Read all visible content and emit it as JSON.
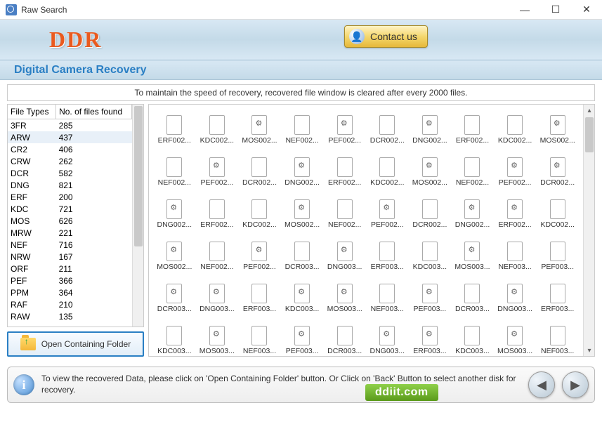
{
  "window": {
    "title": "Raw Search"
  },
  "header": {
    "logo": "DDR",
    "product": "Digital Camera Recovery",
    "contact_label": "Contact us"
  },
  "notice": "To maintain the speed of recovery, recovered file window is cleared after every 2000 files.",
  "file_types_table": {
    "columns": [
      "File Types",
      "No. of files found"
    ],
    "rows": [
      {
        "type": "3FR",
        "count": 285
      },
      {
        "type": "ARW",
        "count": 437
      },
      {
        "type": "CR2",
        "count": 406
      },
      {
        "type": "CRW",
        "count": 262
      },
      {
        "type": "DCR",
        "count": 582
      },
      {
        "type": "DNG",
        "count": 821
      },
      {
        "type": "ERF",
        "count": 200
      },
      {
        "type": "KDC",
        "count": 721
      },
      {
        "type": "MOS",
        "count": 626
      },
      {
        "type": "MRW",
        "count": 221
      },
      {
        "type": "NEF",
        "count": 716
      },
      {
        "type": "NRW",
        "count": 167
      },
      {
        "type": "ORF",
        "count": 211
      },
      {
        "type": "PEF",
        "count": 366
      },
      {
        "type": "PPM",
        "count": 364
      },
      {
        "type": "RAF",
        "count": 210
      },
      {
        "type": "RAW",
        "count": 135
      }
    ]
  },
  "open_folder_label": "Open Containing Folder",
  "files": [
    {
      "name": "ERF002...",
      "gear": false
    },
    {
      "name": "KDC002...",
      "gear": false
    },
    {
      "name": "MOS002...",
      "gear": true
    },
    {
      "name": "NEF002...",
      "gear": false
    },
    {
      "name": "PEF002...",
      "gear": true
    },
    {
      "name": "DCR002...",
      "gear": false
    },
    {
      "name": "DNG002...",
      "gear": true
    },
    {
      "name": "ERF002...",
      "gear": false
    },
    {
      "name": "KDC002...",
      "gear": false
    },
    {
      "name": "MOS002...",
      "gear": true
    },
    {
      "name": "NEF002...",
      "gear": false
    },
    {
      "name": "PEF002...",
      "gear": true
    },
    {
      "name": "DCR002...",
      "gear": false
    },
    {
      "name": "DNG002...",
      "gear": true
    },
    {
      "name": "ERF002...",
      "gear": false
    },
    {
      "name": "KDC002...",
      "gear": false
    },
    {
      "name": "MOS002...",
      "gear": true
    },
    {
      "name": "NEF002...",
      "gear": false
    },
    {
      "name": "PEF002...",
      "gear": true
    },
    {
      "name": "DCR002...",
      "gear": true
    },
    {
      "name": "DNG002...",
      "gear": true
    },
    {
      "name": "ERF002...",
      "gear": false
    },
    {
      "name": "KDC002...",
      "gear": false
    },
    {
      "name": "MOS002...",
      "gear": true
    },
    {
      "name": "NEF002...",
      "gear": false
    },
    {
      "name": "PEF002...",
      "gear": true
    },
    {
      "name": "DCR002...",
      "gear": false
    },
    {
      "name": "DNG002...",
      "gear": true
    },
    {
      "name": "ERF002...",
      "gear": true
    },
    {
      "name": "KDC002...",
      "gear": false
    },
    {
      "name": "MOS002...",
      "gear": true
    },
    {
      "name": "NEF002...",
      "gear": false
    },
    {
      "name": "PEF002...",
      "gear": true
    },
    {
      "name": "DCR003...",
      "gear": false
    },
    {
      "name": "DNG003...",
      "gear": true
    },
    {
      "name": "ERF003...",
      "gear": false
    },
    {
      "name": "KDC003...",
      "gear": false
    },
    {
      "name": "MOS003...",
      "gear": true
    },
    {
      "name": "NEF003...",
      "gear": false
    },
    {
      "name": "PEF003...",
      "gear": false
    },
    {
      "name": "DCR003...",
      "gear": true
    },
    {
      "name": "DNG003...",
      "gear": true
    },
    {
      "name": "ERF003...",
      "gear": false
    },
    {
      "name": "KDC003...",
      "gear": true
    },
    {
      "name": "MOS003...",
      "gear": true
    },
    {
      "name": "NEF003...",
      "gear": false
    },
    {
      "name": "PEF003...",
      "gear": true
    },
    {
      "name": "DCR003...",
      "gear": false
    },
    {
      "name": "DNG003...",
      "gear": true
    },
    {
      "name": "ERF003...",
      "gear": false
    },
    {
      "name": "KDC003...",
      "gear": false
    },
    {
      "name": "MOS003...",
      "gear": true
    },
    {
      "name": "NEF003...",
      "gear": false
    },
    {
      "name": "PEF003...",
      "gear": true
    },
    {
      "name": "DCR003...",
      "gear": false
    },
    {
      "name": "DNG003...",
      "gear": true
    },
    {
      "name": "ERF003...",
      "gear": true
    },
    {
      "name": "KDC003...",
      "gear": false
    },
    {
      "name": "MOS003...",
      "gear": true
    },
    {
      "name": "NEF003...",
      "gear": false
    }
  ],
  "footer": {
    "text": "To view the recovered Data, please click on 'Open Containing Folder' button. Or Click on 'Back' Button to select another disk for recovery."
  },
  "domain_badge": "ddiit.com"
}
